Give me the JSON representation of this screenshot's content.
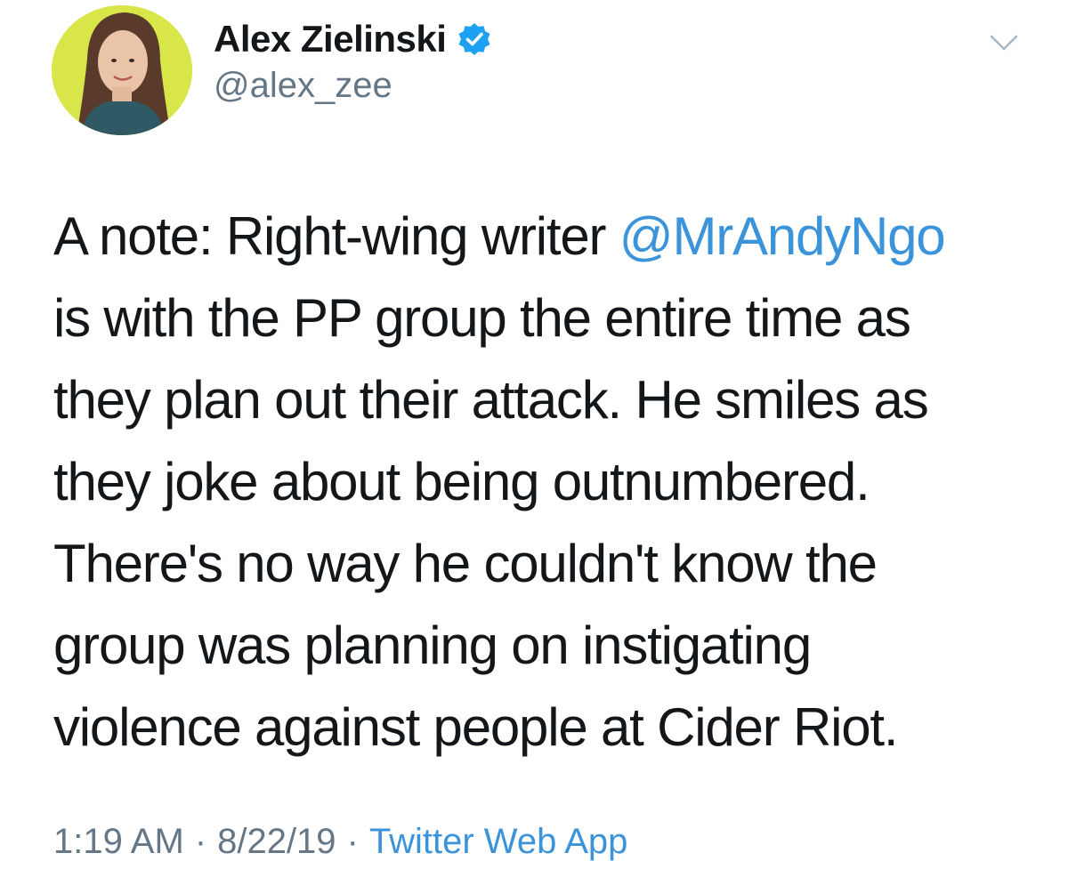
{
  "author": {
    "display_name": "Alex Zielinski",
    "handle": "@alex_zee",
    "verified": true,
    "avatar_icon": "profile-photo"
  },
  "tweet": {
    "lines": [
      {
        "before": "A note: Right-wing writer ",
        "mention": "@MrAndyNgo",
        "after": ""
      },
      {
        "before": "is with the PP group the entire time as"
      },
      {
        "before": "they plan out their attack. He smiles as"
      },
      {
        "before": "they joke about being outnumbered."
      },
      {
        "before": "There's no way he couldn't know the"
      },
      {
        "before": "group was planning on instigating"
      },
      {
        "before": "violence against people at Cider Riot."
      }
    ]
  },
  "meta": {
    "time": "1:19 AM",
    "separator": "·",
    "date": "8/22/19",
    "source": "Twitter Web App"
  },
  "colors": {
    "text": "#14171a",
    "secondary": "#657786",
    "link": "#3b94d9",
    "verified_badge": "#1da1f2",
    "avatar_bg": "#dbe84a"
  },
  "icons": {
    "verified": "verified-badge-icon",
    "menu": "chevron-down-icon"
  }
}
